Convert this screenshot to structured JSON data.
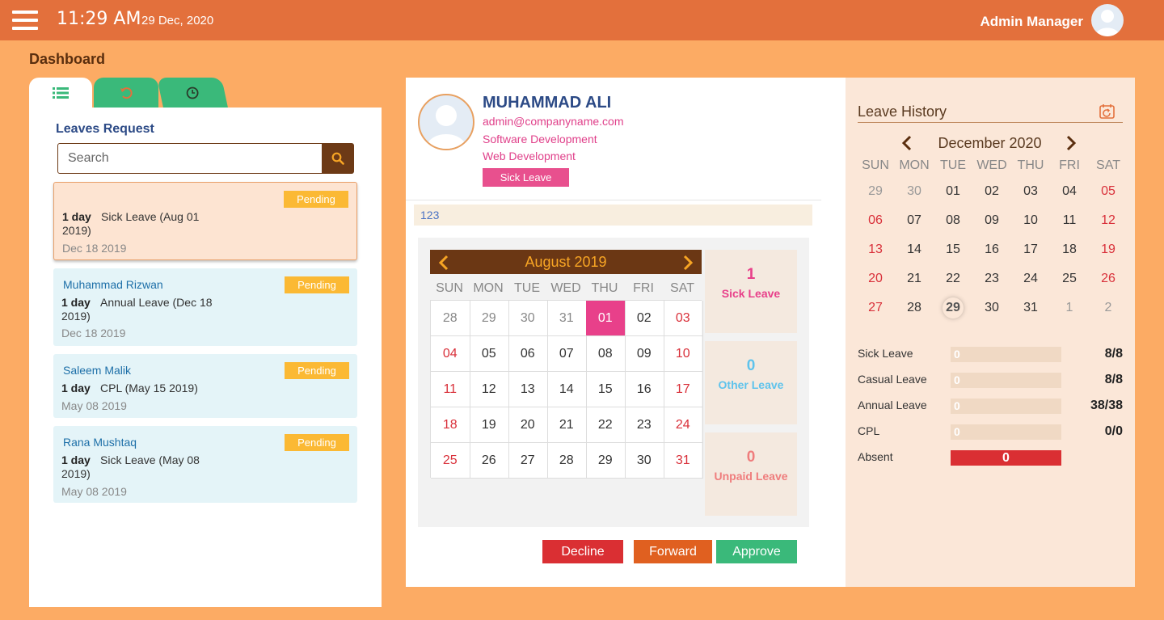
{
  "header": {
    "time": "11:29 AM",
    "date": "29 Dec, 2020",
    "user_name": "Admin Manager"
  },
  "page_title": "Dashboard",
  "leaves": {
    "title": "Leaves Request",
    "search_placeholder": "Search",
    "requests": [
      {
        "name": "",
        "status": "Pending",
        "duration": "1 day",
        "description": "Sick Leave (Aug 01 2019)",
        "date": "Dec 18 2019"
      },
      {
        "name": "Muhammad Rizwan",
        "status": "Pending",
        "duration": "1 day",
        "description": "Annual Leave (Dec 18 2019)",
        "date": "Dec 18 2019"
      },
      {
        "name": "Saleem Malik",
        "status": "Pending",
        "duration": "1 day",
        "description": "CPL (May 15 2019)",
        "date": "May 08 2019"
      },
      {
        "name": "Rana Mushtaq",
        "status": "Pending",
        "duration": "1 day",
        "description": "Sick Leave (May 08 2019)",
        "date": "May 08 2019"
      }
    ]
  },
  "profile": {
    "name": "MUHAMMAD ALI",
    "email": "admin@companyname.com",
    "department": "Software Development",
    "team": "Web Development",
    "leave_type": "Sick Leave",
    "note": "123"
  },
  "month_calendar": {
    "title": "August 2019",
    "weekdays": [
      "SUN",
      "MON",
      "TUE",
      "WED",
      "THU",
      "FRI",
      "SAT"
    ],
    "weeks": [
      [
        "28",
        "29",
        "30",
        "31",
        "01",
        "02",
        "03"
      ],
      [
        "04",
        "05",
        "06",
        "07",
        "08",
        "09",
        "10"
      ],
      [
        "11",
        "12",
        "13",
        "14",
        "15",
        "16",
        "17"
      ],
      [
        "18",
        "19",
        "20",
        "21",
        "22",
        "23",
        "24"
      ],
      [
        "25",
        "26",
        "27",
        "28",
        "29",
        "30",
        "31"
      ]
    ],
    "selected": "01"
  },
  "summary": [
    {
      "count": "1",
      "label": "Sick Leave",
      "color": "#e8408a"
    },
    {
      "count": "0",
      "label": "Other Leave",
      "color": "#5ec3ec"
    },
    {
      "count": "0",
      "label": "Unpaid Leave",
      "color": "#ef7d7d"
    }
  ],
  "actions": {
    "decline": "Decline",
    "forward": "Forward",
    "approve": "Approve"
  },
  "leave_history": {
    "title": "Leave History",
    "month": "December 2020",
    "weekdays": [
      "SUN",
      "MON",
      "TUE",
      "WED",
      "THU",
      "FRI",
      "SAT"
    ],
    "weeks": [
      [
        "29",
        "30",
        "01",
        "02",
        "03",
        "04",
        "05"
      ],
      [
        "06",
        "07",
        "08",
        "09",
        "10",
        "11",
        "12"
      ],
      [
        "13",
        "14",
        "15",
        "16",
        "17",
        "18",
        "19"
      ],
      [
        "20",
        "21",
        "22",
        "23",
        "24",
        "25",
        "26"
      ],
      [
        "27",
        "28",
        "29",
        "30",
        "31",
        "1",
        "2"
      ]
    ],
    "today": "29",
    "balances": [
      {
        "label": "Sick Leave",
        "used": "0",
        "value": "8/8"
      },
      {
        "label": "Casual Leave",
        "used": "0",
        "value": "8/8"
      },
      {
        "label": "Annual Leave",
        "used": "0",
        "value": "38/38"
      },
      {
        "label": "CPL",
        "used": "0",
        "value": "0/0"
      },
      {
        "label": "Absent",
        "used": "0",
        "value": ""
      }
    ]
  },
  "colors": {
    "topbar": "#e3703c",
    "background": "#fcab64",
    "decline": "#da2f33",
    "forward": "#e06020",
    "approve": "#3ab97a",
    "pending": "#fbb934"
  }
}
